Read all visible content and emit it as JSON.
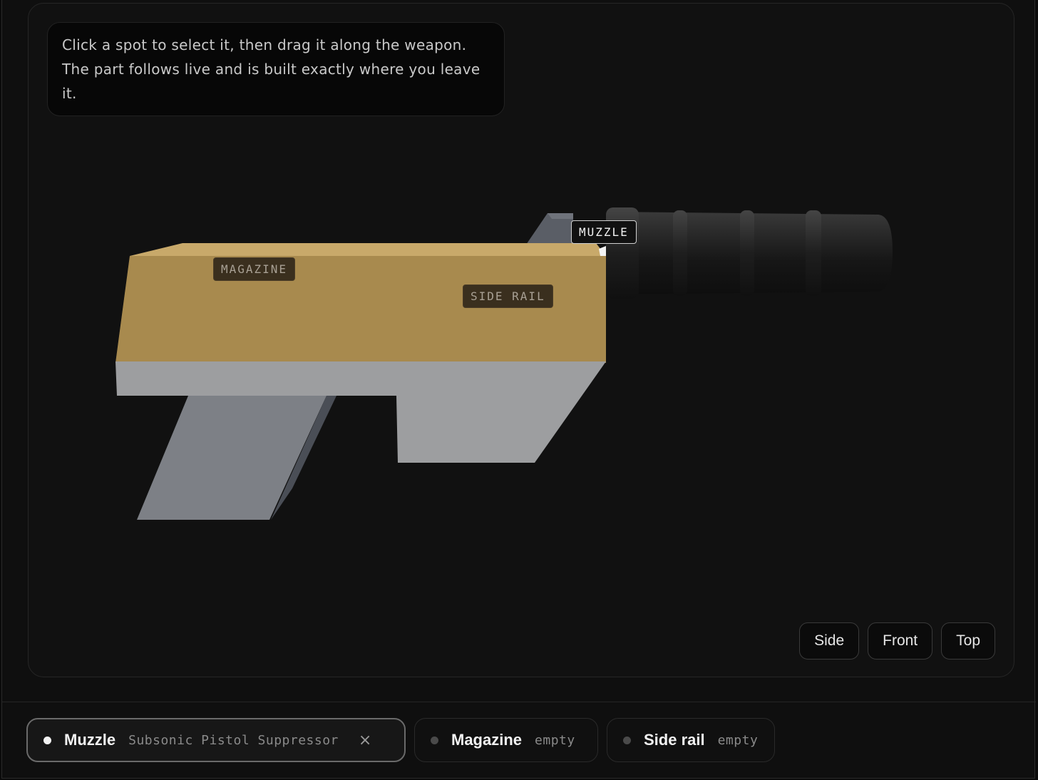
{
  "hint": {
    "text": "Click a spot to select it, then drag it along the weapon. The part follows live and is built exactly where you leave it."
  },
  "hotspots": {
    "magazine": "MAGAZINE",
    "side_rail": "SIDE RAIL",
    "muzzle": "MUZZLE"
  },
  "view_buttons": [
    "Side",
    "Front",
    "Top"
  ],
  "slots": [
    {
      "name": "Muzzle",
      "value": "Subsonic Pistol Suppressor",
      "remove": "×",
      "selected": true
    },
    {
      "name": "Magazine",
      "value": "empty",
      "selected": false
    },
    {
      "name": "Side rail",
      "value": "empty",
      "selected": false
    }
  ],
  "colors": {
    "slide_top": "#c8a96a",
    "slide_front": "#a88a4e",
    "frame": "#9d9ea0",
    "grip": "#7d8086",
    "suppressor": "#1c1c1c",
    "sight": "#5a5e66"
  },
  "icons": {
    "slot_dot": "status-dot-icon",
    "remove": "close-icon"
  }
}
